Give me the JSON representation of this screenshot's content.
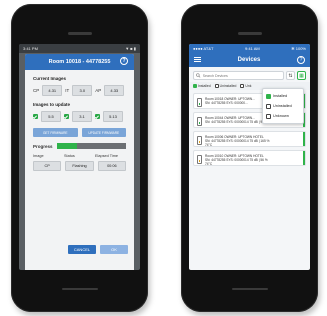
{
  "left_phone": {
    "status": {
      "left": "3:41 PM",
      "right": "▼ ■ ▮"
    },
    "dialog": {
      "title": "Room 10018 - 44778255",
      "current_images_label": "Current Images",
      "current": [
        {
          "label": "CP",
          "value": "4.31"
        },
        {
          "label": "IT",
          "value": "3.0"
        },
        {
          "label": "AP",
          "value": "4.33"
        }
      ],
      "update_label": "Images to update",
      "updates": [
        "5.5",
        "3.1",
        "5.13"
      ],
      "get_firmware": "GET FIRMWARE",
      "update_firmware": "UPDATE FIRMWARE",
      "progress_label": "Progress",
      "progress": 0.3,
      "table_headers": [
        "Image",
        "Status",
        "Elapsed Time"
      ],
      "table_row": [
        "CP",
        "Flashing",
        "00:06"
      ],
      "cancel": "CANCEL",
      "ok": "OK"
    }
  },
  "right_phone": {
    "status": {
      "left": "●●●● AT&T",
      "center": "9:41 AM",
      "right": "✻ 100%"
    },
    "title": "Devices",
    "search_placeholder": "Search Devices",
    "filters": [
      "Installed",
      "Uninstalled",
      "Unk"
    ],
    "dropdown": [
      {
        "label": "Installed",
        "checked": true
      },
      {
        "label": "Uninstalled",
        "checked": false
      },
      {
        "label": "Unknown",
        "checked": false
      }
    ],
    "devices": [
      {
        "line1": "Room 10018  OWNER: UPTOWN...",
        "line2": "SN: 44778255   SYS: 000000...",
        "line3": "",
        "warn": false
      },
      {
        "line1": "Room 10044  OWNER: UPTOWN...",
        "line2": "SN: 44778255   SYS: 00000014   75 dB | 99 %",
        "line3": "",
        "warn": false
      },
      {
        "line1": "Room 10006  OWNER: UPTOWN HOTEL",
        "line2": "SN: 44778255   SYS: 00000014   75 dB | 165 %",
        "line3": "74°C",
        "warn": true
      },
      {
        "line1": "Room 10010  OWNER: UPTOWN HOTEL",
        "line2": "SN: 44778255   SYS: 00000014   75 dB | 56 %",
        "line3": "74°C",
        "warn": true
      }
    ]
  },
  "colors": {
    "header_blue": "#2f6fbd",
    "accent_green": "#2fb34a",
    "button_light_blue": "#7aa5d8"
  },
  "icons": [
    "help-icon",
    "hamburger-menu-icon",
    "sort-icon",
    "filter-grid-icon",
    "search-icon",
    "device-icon",
    "check-icon"
  ]
}
